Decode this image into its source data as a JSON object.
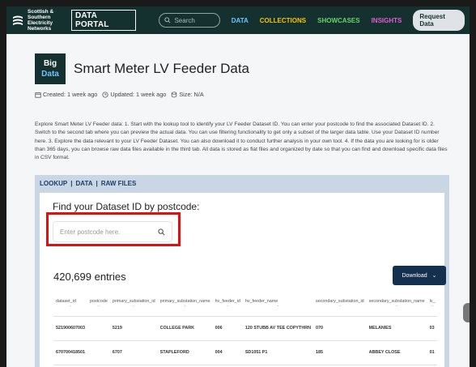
{
  "nav": {
    "logo_text": "Scottish & Southern Electricity Networks",
    "portal": "DATA PORTAL",
    "search_placeholder": "Search",
    "links": [
      "DATA",
      "COLLECTIONS",
      "SHOWCASES",
      "INSIGHTS"
    ],
    "request_button": "Request Data",
    "colors": {
      "data": "#6fc3ff",
      "collections": "#f5c400",
      "showcases": "#6ad36a",
      "insights": "#e05cd3"
    }
  },
  "header": {
    "badge_line1": "Big",
    "badge_line2": "Data",
    "title": "Smart Meter LV Feeder Data",
    "created": "Created: 1 week ago",
    "updated": "Updated: 1 week ago",
    "size": "Size: N/A"
  },
  "description": "Explore Smart Meter LV Feeder data: 1. Start with the lookup tool to identify your LV Feeder Dataset ID. You can enter your postcode to find the associated Dataset ID. 2. Switch to the second tab where you can preview the actual data. You can use filtering functionality to get only a subset of the larger data table. Use your Dataset ID number here. 3. Explore the data relevant to your LV Feeder Dataset. You can also download it to conduct further analysis in your own tool. 4. If the data you are looking for is older than 365 days, you can browse raw data files available in the third tab. All data is stored as flat files and organized by date so that you can find and download specific data files in CSV format.",
  "tabs": [
    "LOOKUP",
    "DATA",
    "RAW FILES"
  ],
  "lookup": {
    "heading": "Find your Dataset ID by postcode:",
    "placeholder": "Enter postcode here."
  },
  "entries": "420,699 entries",
  "download_button": "Download",
  "table": {
    "columns": [
      "dataset_id",
      "postcode",
      "primary_substation_id",
      "primary_substation_name",
      "hv_feeder_id",
      "hv_feeder_name",
      "secondary_substation_id",
      "secondary_substation_name",
      "lv_"
    ],
    "rows": [
      [
        "521900607003",
        "",
        "5219",
        "COLLEGE PARK",
        "006",
        "120 STUBB AV TEE COPYTHRN",
        "070",
        "MELANIES",
        "03"
      ],
      [
        "670700418501",
        "",
        "6707",
        "STAPLEFORD",
        "004",
        "SD1051 P1",
        "185",
        "ABBEY CLOSE",
        "01"
      ]
    ]
  }
}
